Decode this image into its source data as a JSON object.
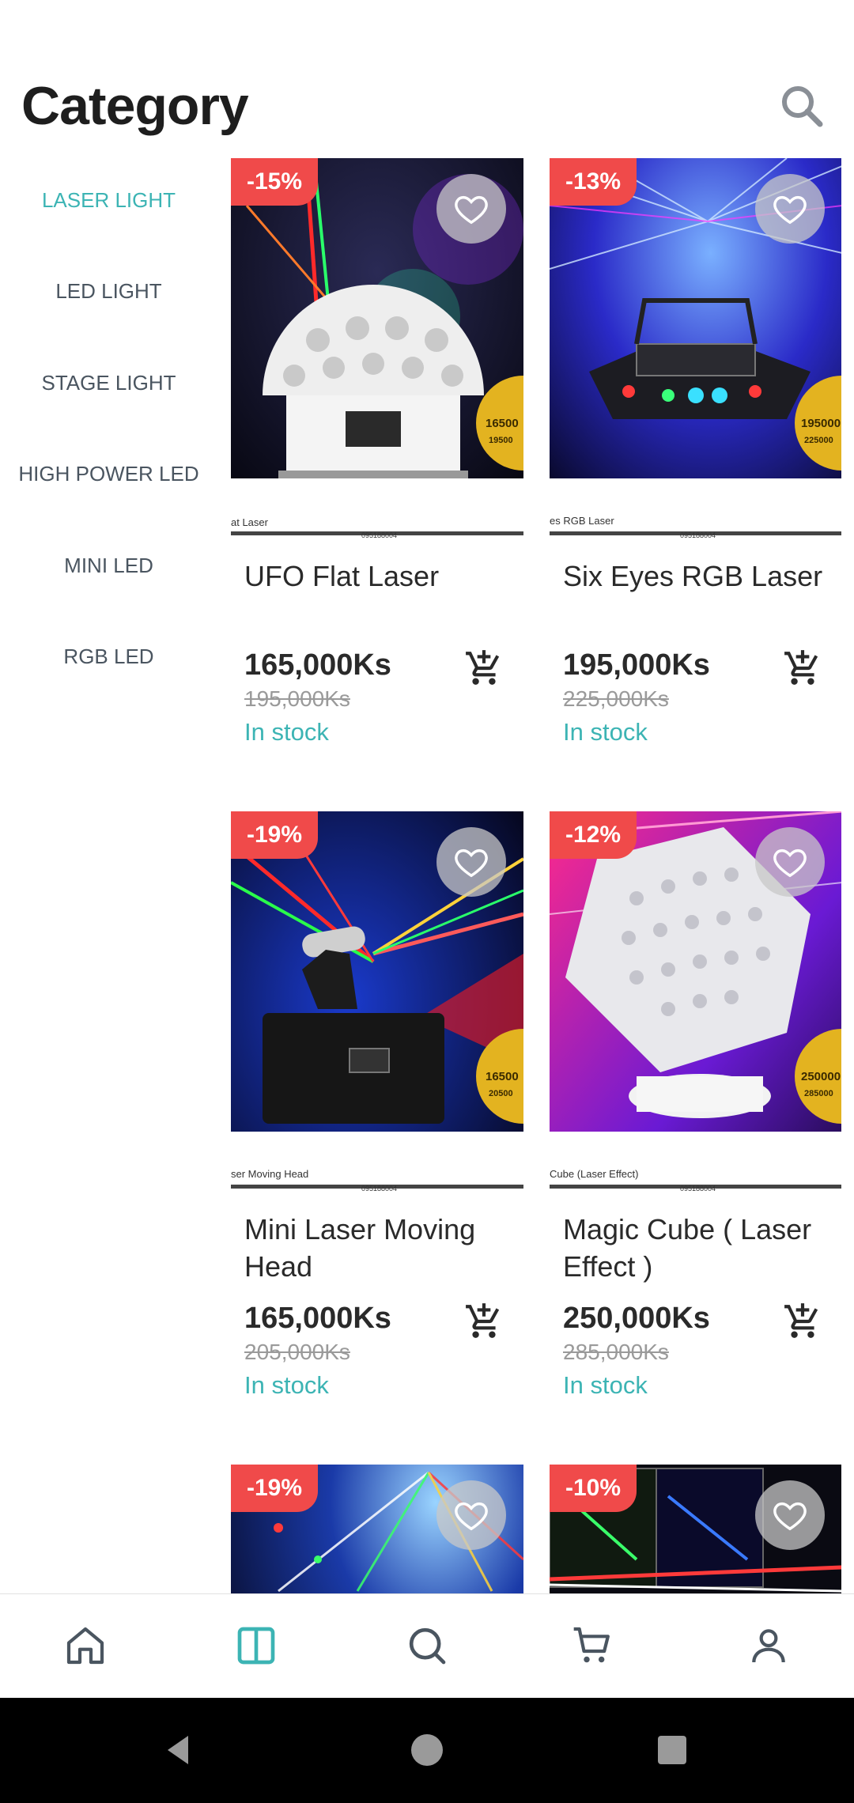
{
  "header": {
    "title": "Category"
  },
  "icons": {
    "search": "search-icon",
    "favorite": "heart-icon",
    "add_to_cart": "add-shopping-cart-icon"
  },
  "colors": {
    "accent": "#3cb4b4",
    "discount_badge": "#f04a4a",
    "text": "#2a2a2a"
  },
  "sidebar": {
    "items": [
      {
        "label": "LASER LIGHT",
        "active": true
      },
      {
        "label": "LED LIGHT",
        "active": false
      },
      {
        "label": "STAGE LIGHT",
        "active": false
      },
      {
        "label": "HIGH POWER LED",
        "active": false
      },
      {
        "label": "MINI LED",
        "active": false
      },
      {
        "label": "RGB LED",
        "active": false
      }
    ]
  },
  "products": [
    {
      "discount": "-15%",
      "name": "UFO Flat Laser",
      "price": "165,000Ks",
      "old_price": "195,000Ks",
      "stock": "In stock",
      "image_caption": "at Laser",
      "image_phone": "095188004",
      "seal_price": "16500",
      "seal_old": "19500"
    },
    {
      "discount": "-13%",
      "name": "Six Eyes RGB Laser",
      "price": "195,000Ks",
      "old_price": "225,000Ks",
      "stock": "In stock",
      "image_caption": "es RGB Laser",
      "image_phone": "095188004",
      "seal_price": "195000",
      "seal_old": "225000"
    },
    {
      "discount": "-19%",
      "name": "Mini Laser Moving Head",
      "price": "165,000Ks",
      "old_price": "205,000Ks",
      "stock": "In stock",
      "image_caption": "ser Moving Head",
      "image_phone": "095188004",
      "seal_price": "16500",
      "seal_old": "20500"
    },
    {
      "discount": "-12%",
      "name": "Magic Cube ( Laser Effect )",
      "price": "250,000Ks",
      "old_price": "285,000Ks",
      "stock": "In stock",
      "image_caption": "Cube (Laser Effect)",
      "image_phone": "095188004",
      "seal_price": "250000",
      "seal_old": "285000"
    },
    {
      "discount": "-19%"
    },
    {
      "discount": "-10%"
    }
  ],
  "bottom_nav": {
    "items": [
      {
        "icon": "home-icon",
        "active": false
      },
      {
        "icon": "category-icon",
        "active": true
      },
      {
        "icon": "search-icon",
        "active": false
      },
      {
        "icon": "cart-icon",
        "active": false
      },
      {
        "icon": "profile-icon",
        "active": false
      }
    ]
  },
  "system_nav": {
    "icons": [
      "back-icon",
      "home-circle-icon",
      "recents-icon"
    ]
  }
}
